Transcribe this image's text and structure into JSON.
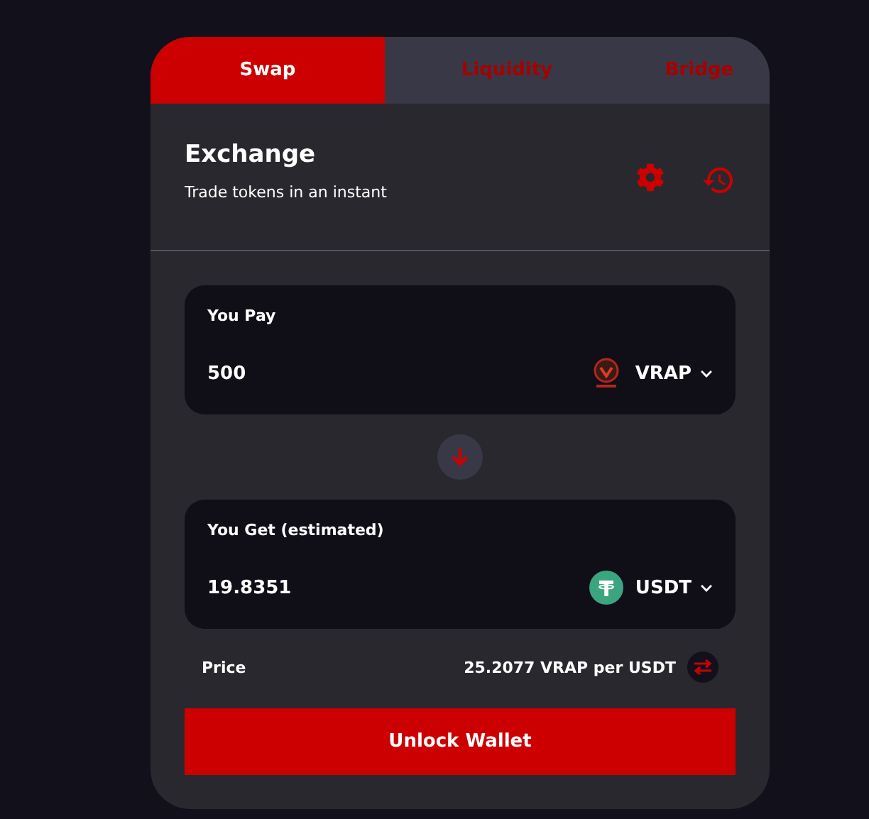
{
  "tabs": [
    {
      "label": "Swap",
      "selected": true
    },
    {
      "label": "Liquidity",
      "selected": false
    },
    {
      "label": "Bridge",
      "selected": false
    }
  ],
  "header": {
    "title": "Exchange",
    "subtitle": "Trade tokens in an instant"
  },
  "pay": {
    "label": "You Pay",
    "amount": "500",
    "token": {
      "symbol": "VRAP",
      "kind": "vrap"
    }
  },
  "get": {
    "label": "You Get (estimated)",
    "amount": "19.8351",
    "token": {
      "symbol": "USDT",
      "kind": "usdt"
    }
  },
  "price": {
    "label": "Price",
    "value": "25.2077 VRAP per USDT"
  },
  "action": {
    "label": "Unlock Wallet"
  }
}
